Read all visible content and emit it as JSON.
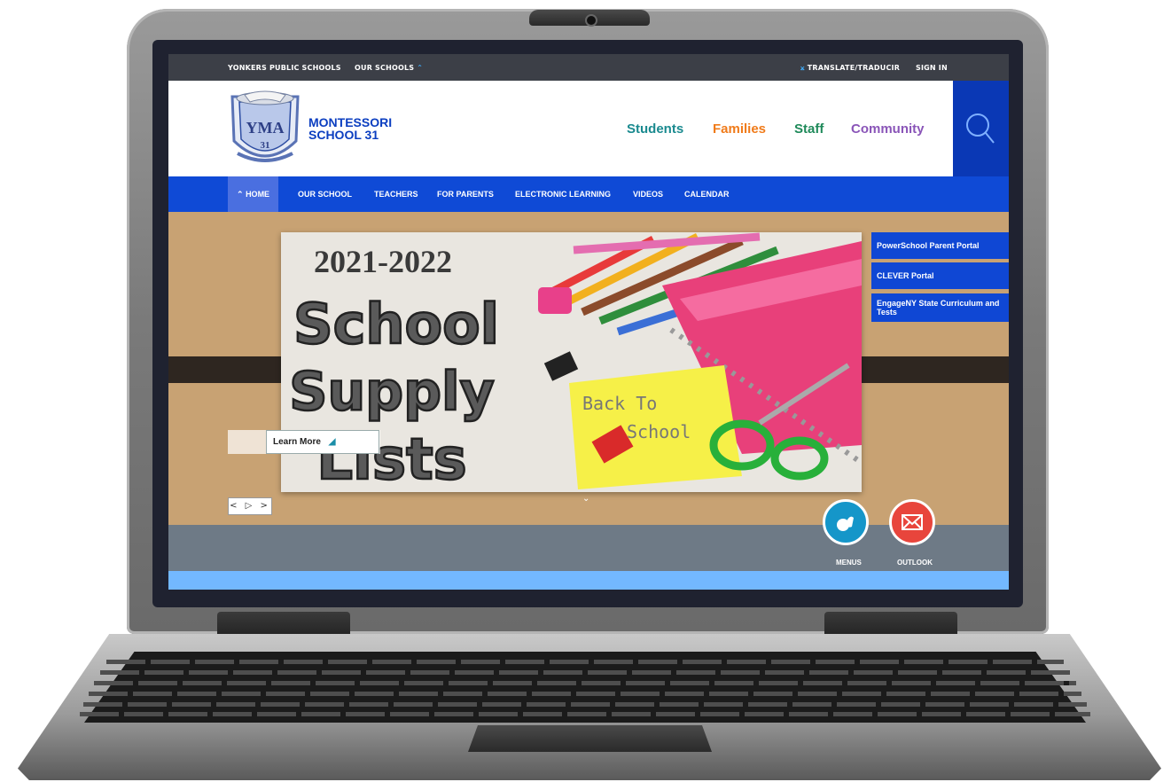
{
  "topbar": {
    "district": "YONKERS PUBLIC SCHOOLS",
    "our_schools": "OUR SCHOOLS",
    "translate": "TRANSLATE/TRADUCIR",
    "sign_in": "SIGN IN"
  },
  "header": {
    "crest_text": "YMA",
    "crest_number": "31",
    "name_line1": "MONTESSORI",
    "name_line2": "SCHOOL 31",
    "audiences": [
      {
        "label": "Students",
        "color": "#1a8a8f"
      },
      {
        "label": "Families",
        "color": "#f07b1a"
      },
      {
        "label": "Staff",
        "color": "#1f8a5a"
      },
      {
        "label": "Community",
        "color": "#8a55b8"
      }
    ]
  },
  "nav": {
    "items": [
      "HOME",
      "OUR SCHOOL",
      "TEACHERS",
      "FOR PARENTS",
      "ELECTRONIC LEARNING",
      "VIDEOS",
      "CALENDAR"
    ]
  },
  "hero": {
    "year": "2021-2022",
    "title_lines": [
      "School",
      "Supply",
      "Lists"
    ],
    "note_line1": "Back To",
    "note_line2": "School",
    "learn_more": "Learn More",
    "slide_controls": "< ▷ >"
  },
  "quick_links": [
    "PowerSchool Parent Portal",
    "CLEVER Portal",
    "EngageNY State Curriculum and Tests"
  ],
  "circles": [
    {
      "label": "MENUS",
      "color": "#1596c9",
      "icon": "apple-icon"
    },
    {
      "label": "OUTLOOK",
      "color": "#e8453c",
      "icon": "envelope-icon"
    }
  ]
}
